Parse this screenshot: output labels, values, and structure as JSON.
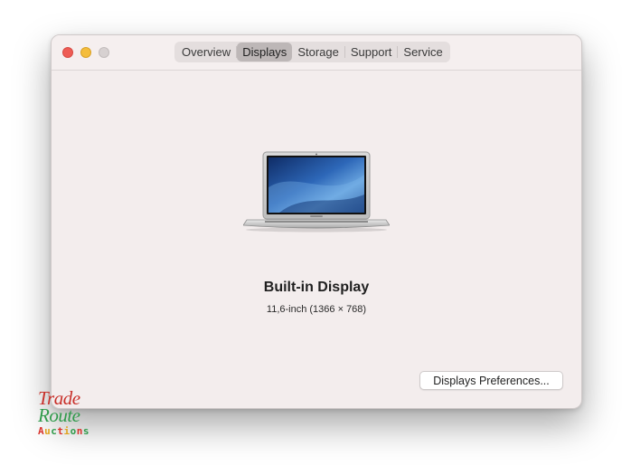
{
  "window": {
    "tabs": [
      {
        "label": "Overview",
        "active": false
      },
      {
        "label": "Displays",
        "active": true
      },
      {
        "label": "Storage",
        "active": false
      },
      {
        "label": "Support",
        "active": false
      },
      {
        "label": "Service",
        "active": false
      }
    ]
  },
  "display": {
    "name": "Built-in Display",
    "spec": "11,6-inch (1366 × 768)",
    "preferences_button": "Displays Preferences..."
  },
  "watermark": {
    "line1": "Trade",
    "line2": "Route",
    "line3": "Auctions"
  },
  "colors": {
    "close": "#ee5c55",
    "minimize": "#f4bd3c",
    "zoom_disabled": "#d7d1d1",
    "window_bg": "#f3eded",
    "active_tab": "#bdb7b7"
  }
}
